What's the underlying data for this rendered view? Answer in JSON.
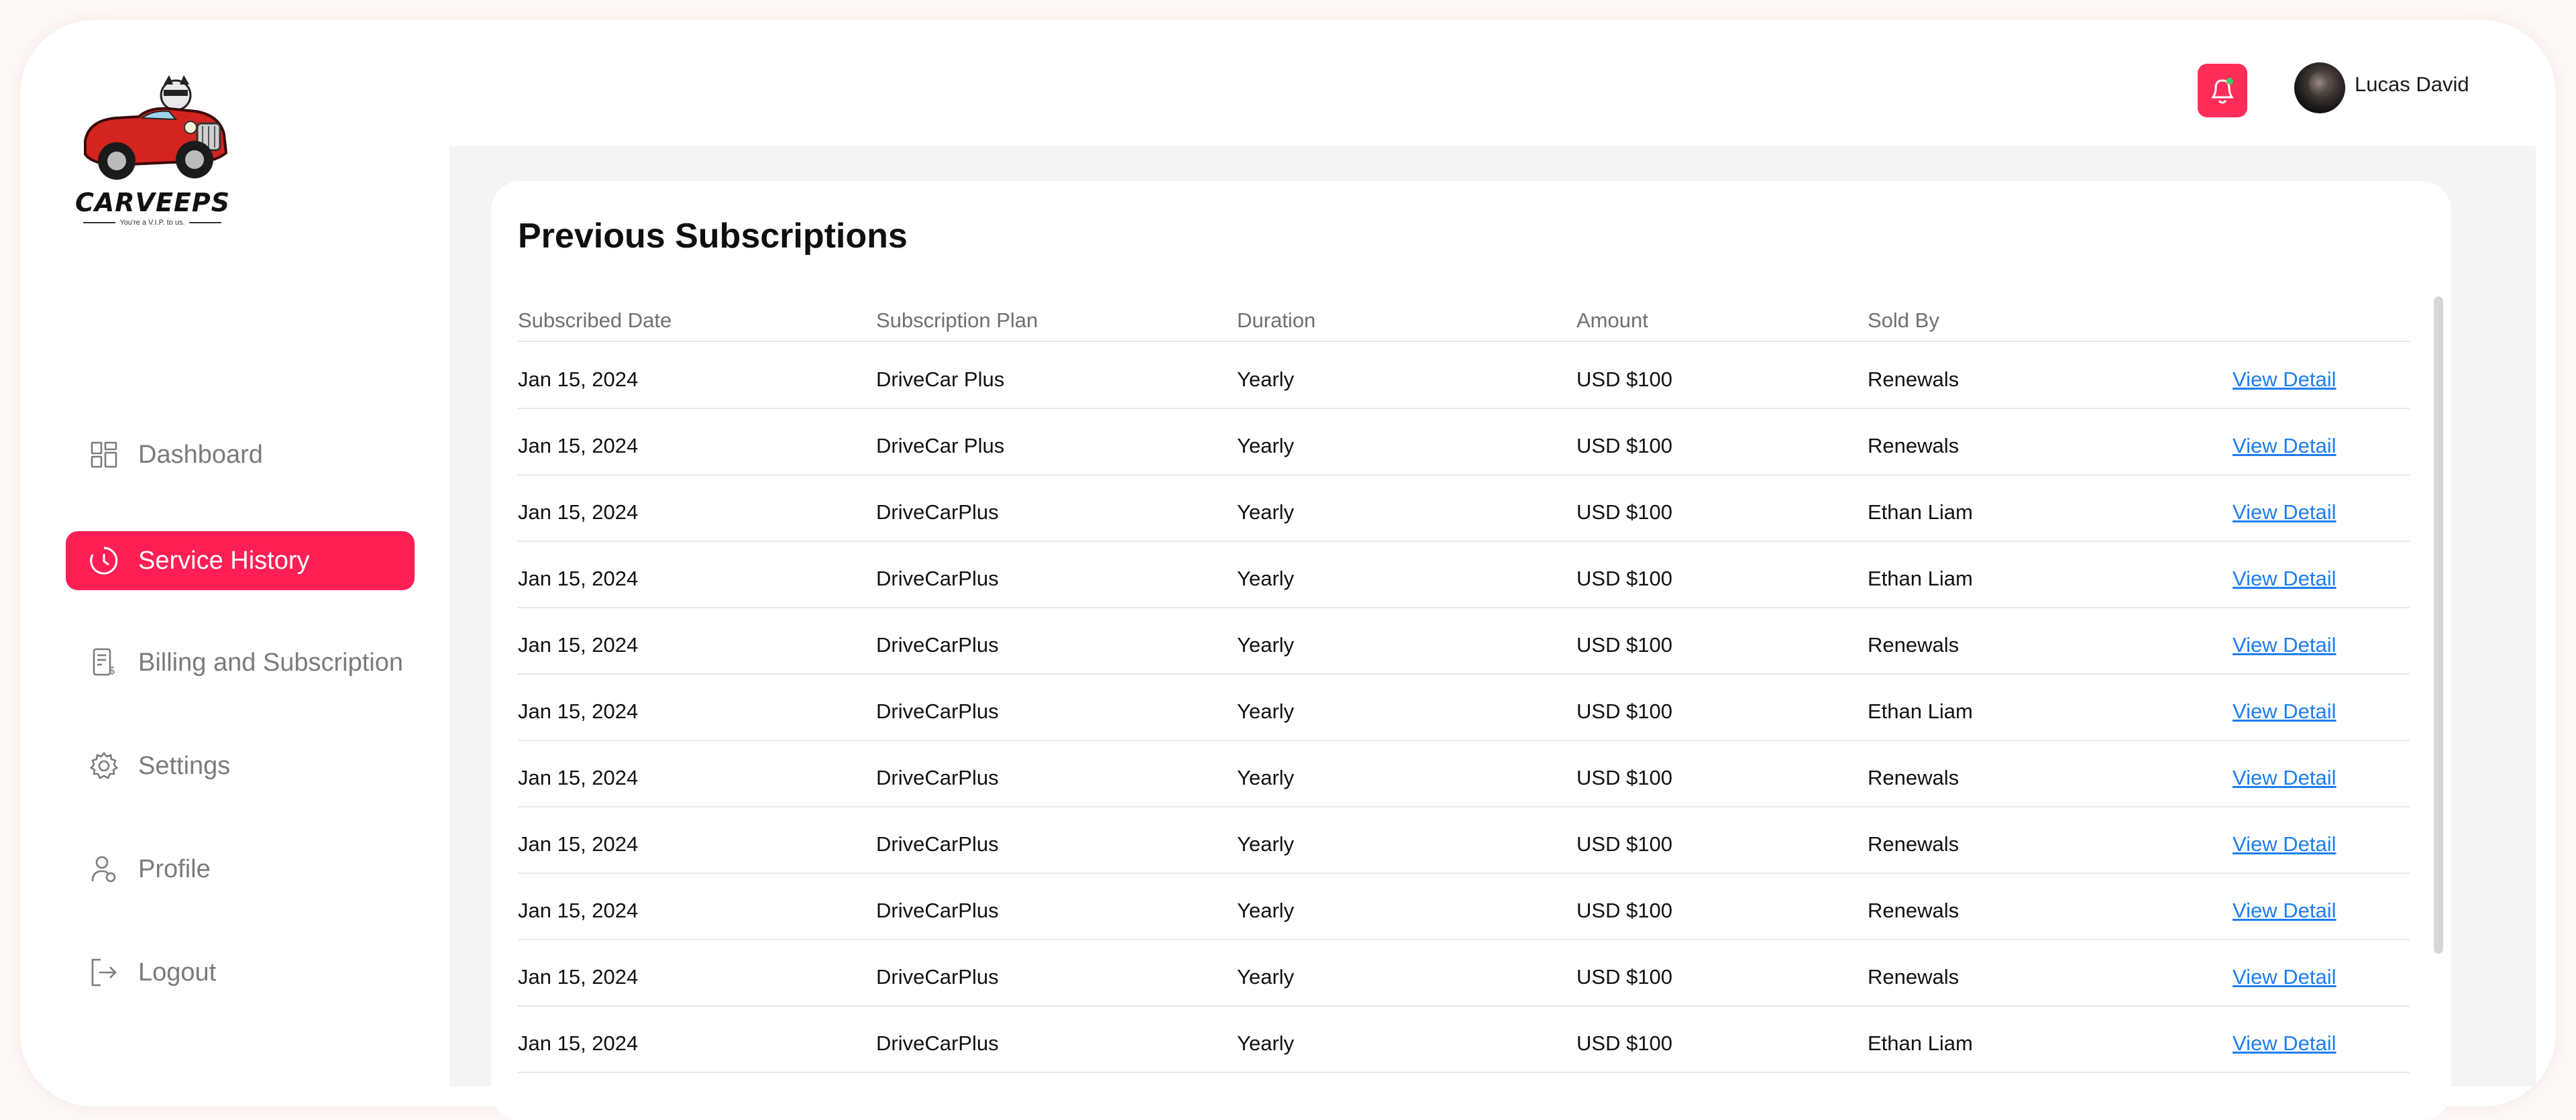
{
  "brand": {
    "name": "CARVEEPS",
    "tagline": "You're a V.I.P. to us."
  },
  "sidebar": {
    "items": [
      {
        "label": "Dashboard",
        "icon": "dashboard-icon",
        "active": false
      },
      {
        "label": "Service History",
        "icon": "clock-icon",
        "active": true
      },
      {
        "label": "Billing and Subscription",
        "icon": "invoice-icon",
        "active": false
      },
      {
        "label": "Settings",
        "icon": "gear-icon",
        "active": false
      },
      {
        "label": "Profile",
        "icon": "user-icon",
        "active": false
      },
      {
        "label": "Logout",
        "icon": "logout-icon",
        "active": false
      }
    ]
  },
  "header": {
    "user_name": "Lucas David",
    "notification_icon": "bell-icon"
  },
  "colors": {
    "accent": "#ff1f55",
    "link": "#1e7df0",
    "content_bg": "#f4f4f4"
  },
  "table": {
    "title": "Previous Subscriptions",
    "columns": [
      "Subscribed Date",
      "Subscription Plan",
      "Duration",
      "Amount",
      "Sold By"
    ],
    "rows": [
      {
        "date": "Jan 15, 2024",
        "plan": "DriveCar Plus",
        "duration": "Yearly",
        "amount": "USD $100",
        "sold_by": "Renewals",
        "action": "View Detail"
      },
      {
        "date": "Jan 15, 2024",
        "plan": "DriveCar Plus",
        "duration": "Yearly",
        "amount": "USD $100",
        "sold_by": "Renewals",
        "action": "View Detail"
      },
      {
        "date": "Jan 15, 2024",
        "plan": "DriveCarPlus",
        "duration": "Yearly",
        "amount": "USD $100",
        "sold_by": "Ethan Liam",
        "action": "View Detail"
      },
      {
        "date": "Jan 15, 2024",
        "plan": "DriveCarPlus",
        "duration": "Yearly",
        "amount": "USD $100",
        "sold_by": "Ethan Liam",
        "action": "View Detail"
      },
      {
        "date": "Jan 15, 2024",
        "plan": "DriveCarPlus",
        "duration": "Yearly",
        "amount": "USD $100",
        "sold_by": "Renewals",
        "action": "View Detail"
      },
      {
        "date": "Jan 15, 2024",
        "plan": "DriveCarPlus",
        "duration": "Yearly",
        "amount": "USD $100",
        "sold_by": "Ethan Liam",
        "action": "View Detail"
      },
      {
        "date": "Jan 15, 2024",
        "plan": "DriveCarPlus",
        "duration": "Yearly",
        "amount": "USD $100",
        "sold_by": "Renewals",
        "action": "View Detail"
      },
      {
        "date": "Jan 15, 2024",
        "plan": "DriveCarPlus",
        "duration": "Yearly",
        "amount": "USD $100",
        "sold_by": "Renewals",
        "action": "View Detail"
      },
      {
        "date": "Jan 15, 2024",
        "plan": "DriveCarPlus",
        "duration": "Yearly",
        "amount": "USD $100",
        "sold_by": "Renewals",
        "action": "View Detail"
      },
      {
        "date": "Jan 15, 2024",
        "plan": "DriveCarPlus",
        "duration": "Yearly",
        "amount": "USD $100",
        "sold_by": "Renewals",
        "action": "View Detail"
      },
      {
        "date": "Jan 15, 2024",
        "plan": "DriveCarPlus",
        "duration": "Yearly",
        "amount": "USD $100",
        "sold_by": "Ethan Liam",
        "action": "View Detail"
      }
    ]
  }
}
